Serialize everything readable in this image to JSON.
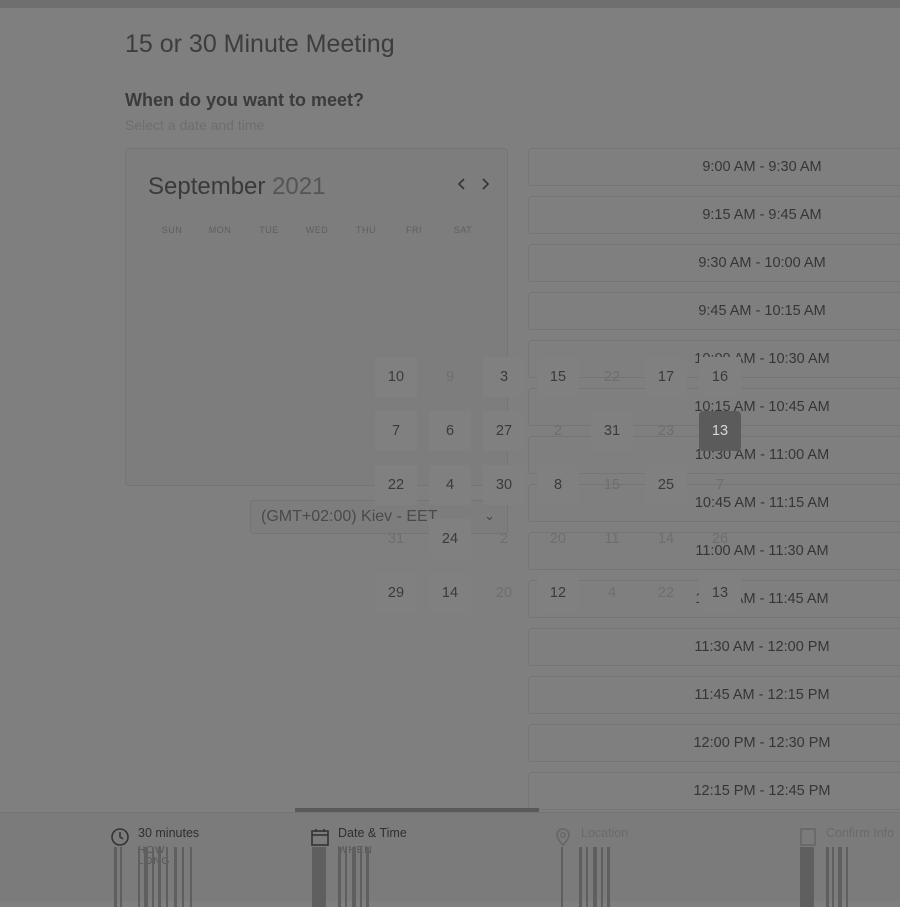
{
  "page": {
    "title": "15 or 30 Minute Meeting",
    "subheading": "When do you want to meet?",
    "helper": "Select a date and time"
  },
  "calendar": {
    "month": "September",
    "year": "2021",
    "prev_icon": "chevron-left-icon",
    "next_icon": "chevron-right-icon",
    "weekdays": [
      "SUN",
      "MON",
      "TUE",
      "WED",
      "THU",
      "FRI",
      "SAT"
    ],
    "grid": [
      [
        {
          "d": "10",
          "m": false
        },
        {
          "d": "9",
          "m": true
        },
        {
          "d": "3",
          "m": false
        },
        {
          "d": "15",
          "m": false
        },
        {
          "d": "22",
          "m": true
        },
        {
          "d": "17",
          "m": false
        },
        {
          "d": "16",
          "m": false
        }
      ],
      [
        {
          "d": "7",
          "m": false
        },
        {
          "d": "6",
          "m": false
        },
        {
          "d": "27",
          "m": false
        },
        {
          "d": "2",
          "m": true
        },
        {
          "d": "31",
          "m": false
        },
        {
          "d": "23",
          "m": true
        },
        {
          "d": "13",
          "m": false,
          "selected": true
        }
      ],
      [
        {
          "d": "22",
          "m": false
        },
        {
          "d": "4",
          "m": false
        },
        {
          "d": "30",
          "m": false
        },
        {
          "d": "8",
          "m": false
        },
        {
          "d": "15",
          "m": true
        },
        {
          "d": "25",
          "m": false
        },
        {
          "d": "7",
          "m": true
        }
      ],
      [
        {
          "d": "31",
          "m": true
        },
        {
          "d": "24",
          "m": false
        },
        {
          "d": "2",
          "m": true
        },
        {
          "d": "20",
          "m": true
        },
        {
          "d": "11",
          "m": true
        },
        {
          "d": "14",
          "m": true
        },
        {
          "d": "26",
          "m": true
        }
      ],
      [
        {
          "d": "29",
          "m": false
        },
        {
          "d": "14",
          "m": false
        },
        {
          "d": "20",
          "m": true
        },
        {
          "d": "12",
          "m": false
        },
        {
          "d": "4",
          "m": true
        },
        {
          "d": "22",
          "m": true
        },
        {
          "d": "13",
          "m": false
        }
      ]
    ]
  },
  "timezone": {
    "value": "(GMT+02:00) Kiev - EET"
  },
  "time_slots": [
    "9:00 AM - 9:30 AM",
    "9:15 AM - 9:45 AM",
    "9:30 AM - 10:00 AM",
    "9:45 AM - 10:15 AM",
    "10:00 AM - 10:30 AM",
    "10:15 AM - 10:45 AM",
    "10:30 AM - 11:00 AM",
    "10:45 AM - 11:15 AM",
    "11:00 AM - 11:30 AM",
    "11:15 AM - 11:45 AM",
    "11:30 AM - 12:00 PM",
    "11:45 AM - 12:15 PM",
    "12:00 PM - 12:30 PM",
    "12:15 PM - 12:45 PM"
  ],
  "steps": [
    {
      "label": "30 minutes",
      "sub": "HOW LONG",
      "icon": "clock-icon"
    },
    {
      "label": "Date & Time",
      "sub": "WHEN",
      "icon": "calendar-icon"
    },
    {
      "label": "Location",
      "sub": "",
      "icon": "location-pin-icon"
    },
    {
      "label": "Confirm Info",
      "sub": "",
      "icon": "document-icon"
    }
  ]
}
